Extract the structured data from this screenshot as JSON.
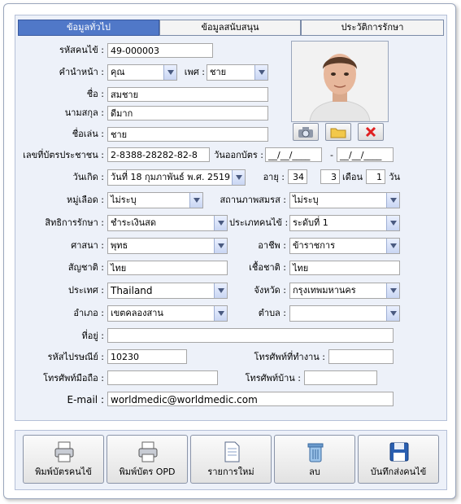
{
  "tabs": [
    "ข้อมูลทั่วไป",
    "ข้อมูลสนับสนุน",
    "ประวัติการรักษา"
  ],
  "labels": {
    "hn": "รหัสคนไข้ :",
    "prefix": "คำนำหน้า :",
    "sex": "เพศ :",
    "fname": "ชื่อ :",
    "lname": "นามสกุล :",
    "nick": "ชื่อเล่น :",
    "idcard": "เลขที่บัตรประชาชน :",
    "issue": "วันออกบัตร :",
    "dash": "-",
    "birth": "วันเกิด :",
    "age": "อายุ :",
    "month": "เดือน",
    "day": "วัน",
    "blood": "หมู่เลือด :",
    "marital": "สถานภาพสมรส :",
    "right": "สิทธิการรักษา :",
    "ptype": "ประเภทคนไข้ :",
    "religion": "ศาสนา :",
    "job": "อาชีพ :",
    "nationality": "สัญชาติ :",
    "race": "เชื้อชาติ :",
    "country": "ประเทศ :",
    "province": "จังหวัด :",
    "district": "อำเภอ :",
    "subdistrict": "ตำบล :",
    "address": "ที่อยู่ :",
    "zip": "รหัสไปรษณีย์ :",
    "worktel": "โทรศัพท์ที่ทำงาน :",
    "mobile": "โทรศัพท์มือถือ :",
    "hometel": "โทรศัพท์บ้าน :",
    "email": "E-mail :"
  },
  "values": {
    "hn": "49-000003",
    "prefix": "คุณ",
    "sex": "ชาย",
    "fname": "สมชาย",
    "lname": "ดีมาก",
    "nick": "ชาย",
    "idcard": "2-8388-28282-82-8",
    "issue_from": "__/__/____",
    "issue_to": "__/__/____",
    "birth": "วันที่ 18 กุมภาพันธ์ พ.ศ. 2519",
    "age_y": "34",
    "age_m": "3",
    "age_d": "1",
    "blood": "ไม่ระบุ",
    "marital": "ไม่ระบุ",
    "right": "ชำระเงินสด",
    "ptype": "ระดับที่ 1",
    "religion": "พุทธ",
    "job": "ข้าราชการ",
    "nationality": "ไทย",
    "race": "ไทย",
    "country": "Thailand",
    "province": "กรุงเทพมหานคร",
    "district": "เขตคลองสาน",
    "subdistrict": "",
    "address": "",
    "zip": "10230",
    "worktel": "",
    "mobile": "",
    "hometel": "",
    "email": "worldmedic@worldmedic.com"
  },
  "buttons": [
    "พิมพ์บัตรคนไข้",
    "พิมพ์บัตร OPD",
    "รายการใหม่",
    "ลบ",
    "บันทึกส่งคนไข้"
  ]
}
